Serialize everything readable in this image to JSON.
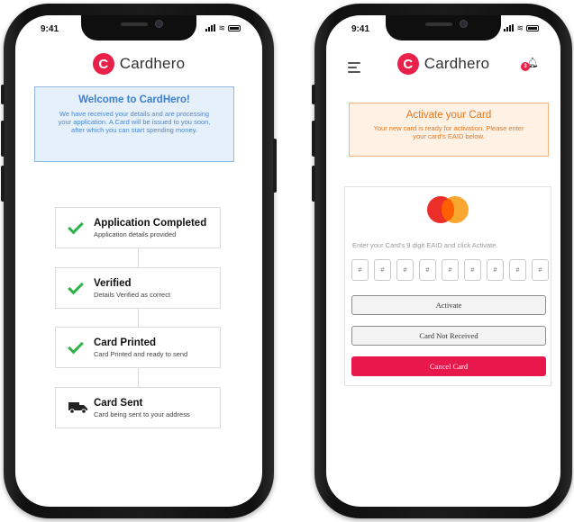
{
  "status_bar": {
    "time": "9:41"
  },
  "brand": {
    "logo_letter": "C",
    "name": "Cardhero"
  },
  "left_screen": {
    "welcome": {
      "title": "Welcome to CardHero!",
      "message_lines": [
        "We have received your details and are processing",
        "your application. A Card will be issued to you soon,",
        "after which you can start spending money."
      ]
    },
    "steps": [
      {
        "title": "Application Completed",
        "subtitle": "Application details provided",
        "icon": "check-icon"
      },
      {
        "title": "Verified",
        "subtitle": "Details Verified as correct",
        "icon": "check-icon"
      },
      {
        "title": "Card Printed",
        "subtitle": "Card Printed and ready to send",
        "icon": "check-icon"
      },
      {
        "title": "Card Sent",
        "subtitle": "Card being sent to your address",
        "icon": "truck-icon"
      }
    ]
  },
  "right_screen": {
    "notification_count": "3",
    "activate": {
      "title": "Activate your Card",
      "message_lines": [
        "Your new card is ready for activation. Please enter",
        "your card's EAID below."
      ]
    },
    "eaid_label": "Enter your Card's 9 digit EAID and click Activate.",
    "digit_placeholder": "#",
    "buttons": {
      "activate": "Activate",
      "not_received": "Card Not Received",
      "cancel": "Cancel Card"
    }
  },
  "colors": {
    "brand_red": "#e8204a",
    "success_green": "#2db34a",
    "info_blue": "#3b7fd0",
    "warning_orange": "#e8751a",
    "cancel_red": "#e8184d"
  }
}
